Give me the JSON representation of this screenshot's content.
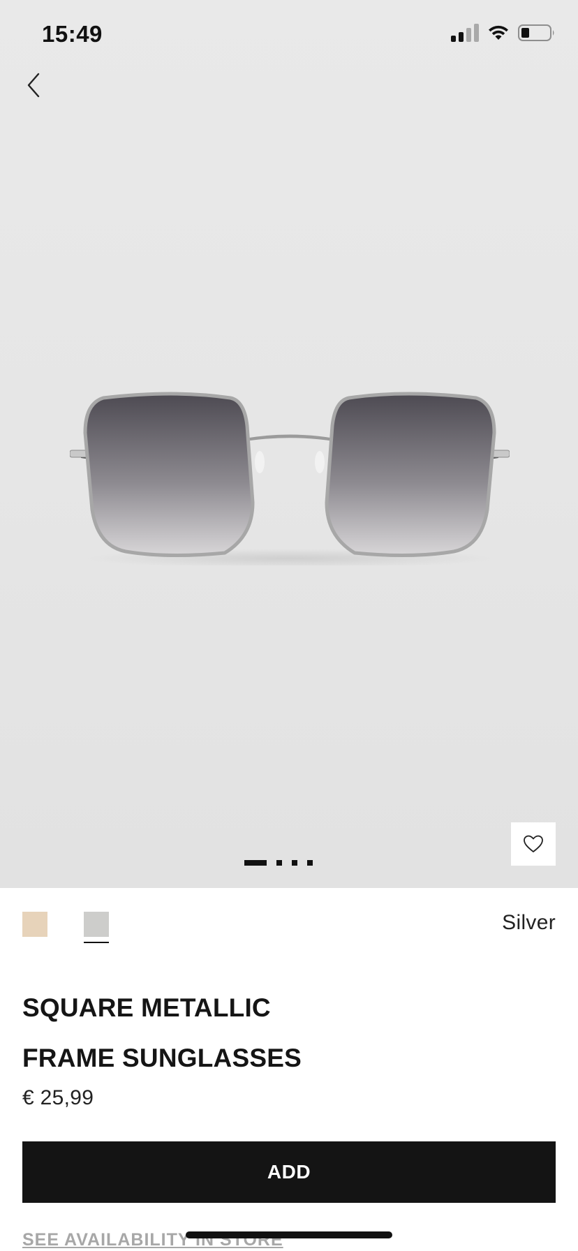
{
  "status_bar": {
    "time": "15:49",
    "icons": [
      "cellular-signal-icon",
      "wifi-icon",
      "battery-icon"
    ]
  },
  "navigation": {
    "back_icon": "chevron-left-icon"
  },
  "gallery": {
    "image_subject": "square metallic frame sunglasses",
    "page_count": 4,
    "current_page": 1,
    "wishlist_icon": "heart-outline-icon"
  },
  "colors": {
    "swatches": [
      {
        "color": "#e7d3ba"
      },
      {
        "color": "#cdcdcb"
      }
    ],
    "selected_index": 1,
    "selected_label": "Silver"
  },
  "product": {
    "title_line1": "SQUARE METALLIC",
    "title_line2": "FRAME SUNGLASSES",
    "price": "€ 25,99"
  },
  "actions": {
    "add_label": "ADD",
    "availability_label": "SEE AVAILABILITY IN STORE"
  },
  "theme": {
    "primary": "#141414",
    "hero_background": "#e7e7e7"
  }
}
